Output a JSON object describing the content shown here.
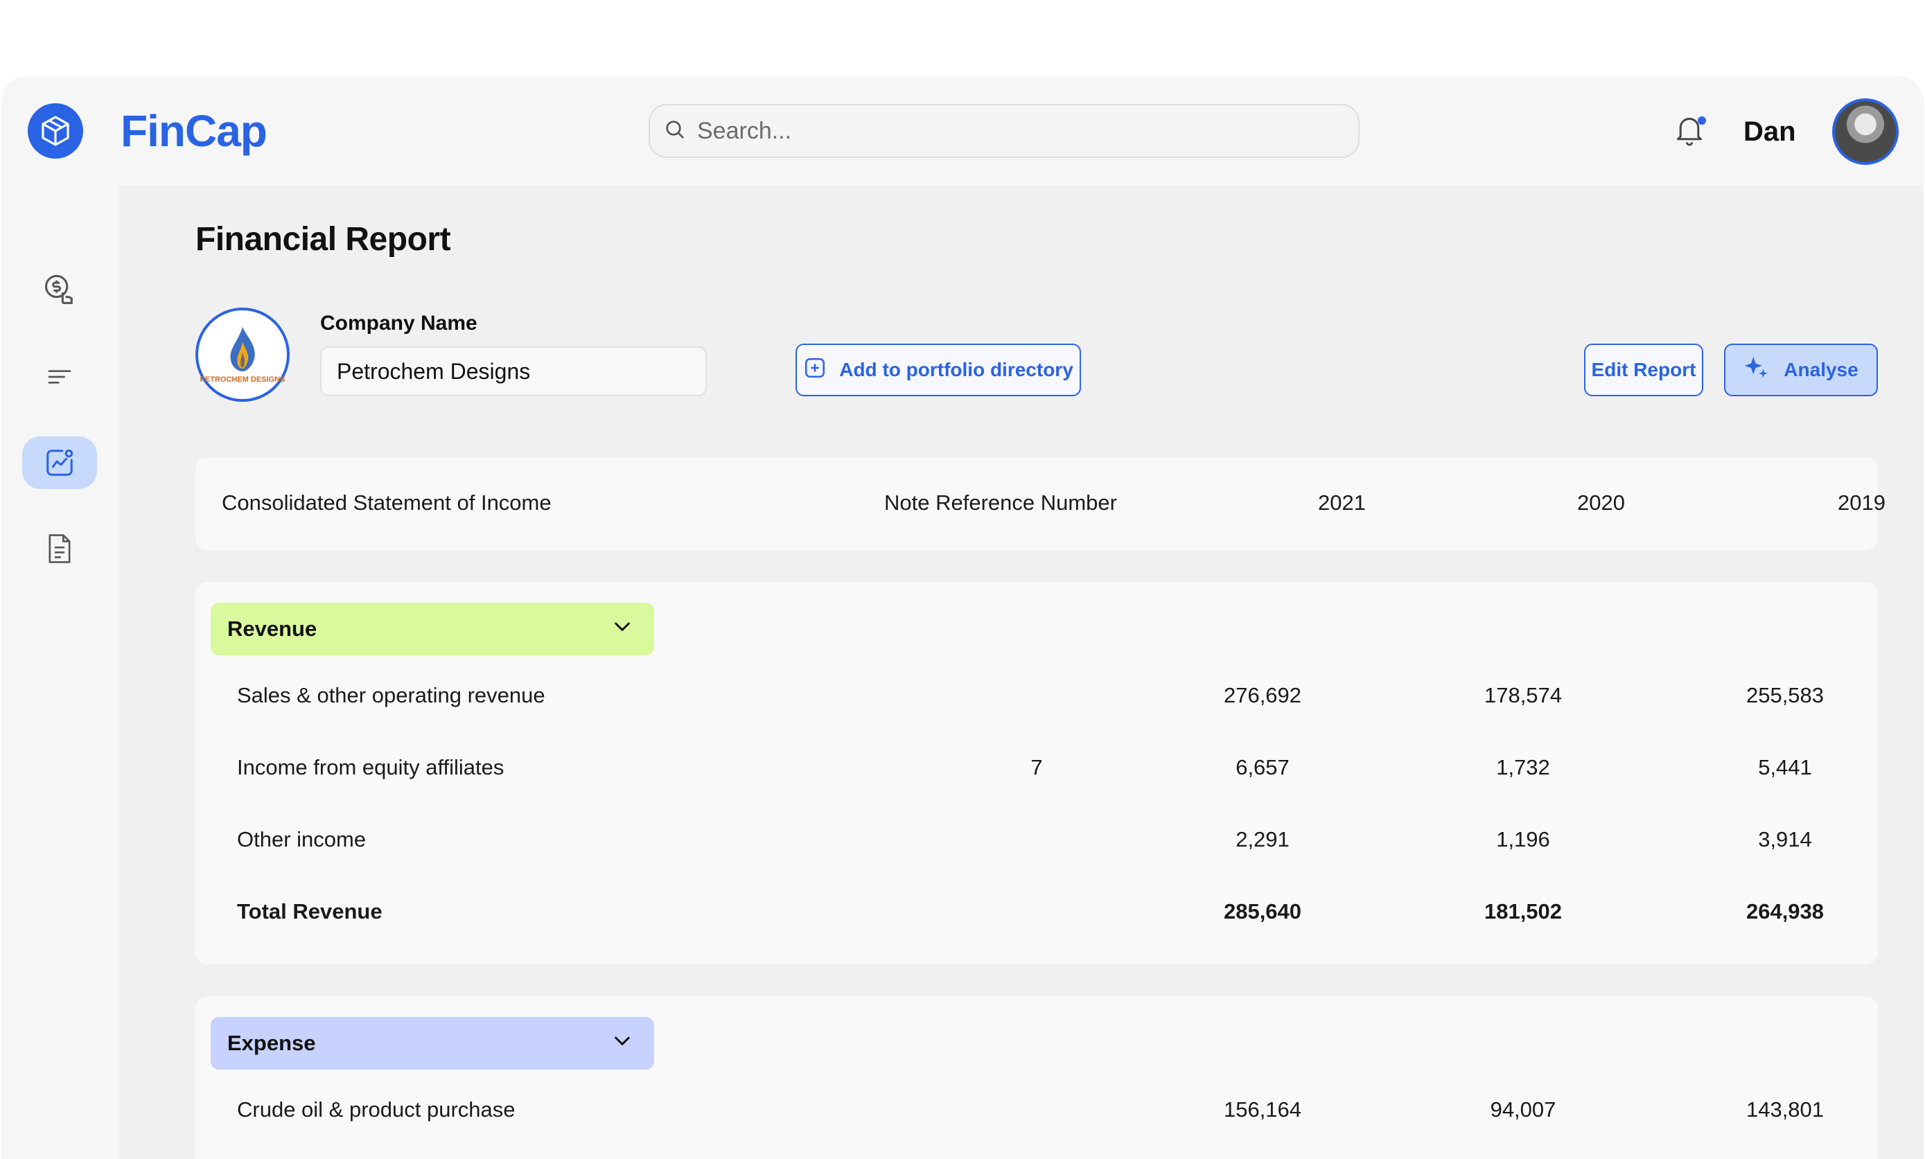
{
  "app": {
    "name": "FinCap"
  },
  "search": {
    "placeholder": "Search..."
  },
  "user": {
    "name": "Dan"
  },
  "page": {
    "title": "Financial Report"
  },
  "company": {
    "label": "Company Name",
    "value": "Petrochem Designs",
    "logo_text": "PETROCHEM DESIGNS"
  },
  "actions": {
    "add_portfolio": "Add to portfolio directory",
    "edit_report": "Edit Report",
    "analyse": "Analyse"
  },
  "table": {
    "header": {
      "statement": "Consolidated Statement of Income",
      "note": "Note Reference Number",
      "years": [
        "2021",
        "2020",
        "2019"
      ]
    },
    "sections": [
      {
        "title": "Revenue",
        "rows": [
          {
            "label": "Sales & other operating revenue",
            "note": "",
            "values": [
              "276,692",
              "178,574",
              "255,583"
            ]
          },
          {
            "label": "Income from equity affiliates",
            "note": "7",
            "values": [
              "6,657",
              "1,732",
              "5,441"
            ]
          },
          {
            "label": "Other income",
            "note": "",
            "values": [
              "2,291",
              "1,196",
              "3,914"
            ]
          },
          {
            "label": "Total Revenue",
            "note": "",
            "values": [
              "285,640",
              "181,502",
              "264,938"
            ]
          }
        ]
      },
      {
        "title": "Expense",
        "rows": [
          {
            "label": "Crude oil & product purchase",
            "note": "",
            "values": [
              "156,164",
              "94,007",
              "143,801"
            ]
          }
        ]
      }
    ]
  },
  "colors": {
    "accent": "#2a63e3",
    "revenue_pill": "#d9f99d",
    "expense_pill": "#c7d2fe",
    "active_nav": "#c7dafb"
  },
  "icons": {
    "logo": "cube-icon",
    "search": "search-icon",
    "notifications": "bell-icon",
    "nav": [
      "finance-touch-icon",
      "list-filter-icon",
      "chart-analytics-icon",
      "document-icon"
    ],
    "add": "plus-square-icon",
    "analyse": "sparkles-icon",
    "collapse": "chevron-down-icon"
  }
}
